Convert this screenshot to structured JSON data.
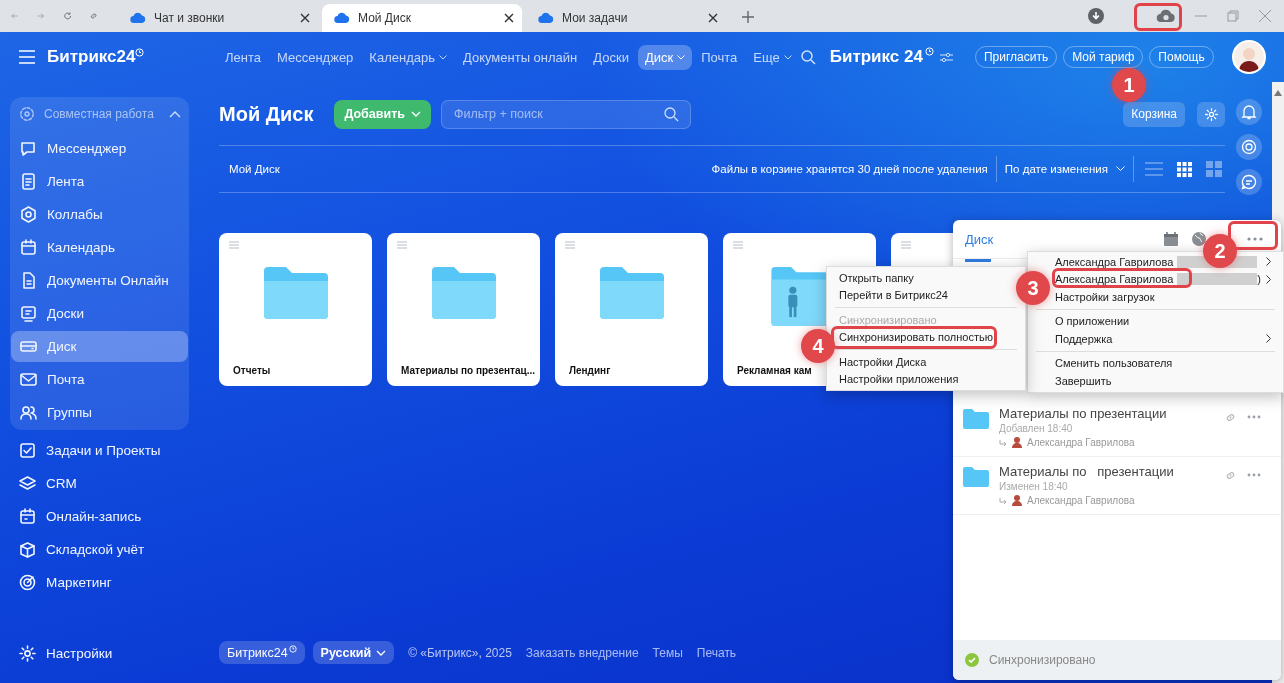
{
  "browser": {
    "tabs": [
      {
        "title": "Чат и звонки",
        "selected": false
      },
      {
        "title": "Мой Диск",
        "selected": true
      },
      {
        "title": "Мои задачи",
        "selected": false
      }
    ]
  },
  "sidebar": {
    "logo": "Битрикс24",
    "group": {
      "title": "Совместная работа",
      "expanded": true,
      "items": [
        {
          "label": "Мессенджер",
          "selected": false
        },
        {
          "label": "Лента",
          "selected": false
        },
        {
          "label": "Коллабы",
          "selected": false
        },
        {
          "label": "Календарь",
          "selected": false
        },
        {
          "label": "Документы Онлайн",
          "selected": false
        },
        {
          "label": "Доски",
          "selected": false
        },
        {
          "label": "Диск",
          "selected": true
        },
        {
          "label": "Почта",
          "selected": false
        },
        {
          "label": "Группы",
          "selected": false
        }
      ]
    },
    "items": [
      {
        "label": "Задачи и Проекты",
        "selected": false
      },
      {
        "label": "CRM",
        "selected": false
      },
      {
        "label": "Онлайн-запись",
        "selected": false
      },
      {
        "label": "Складской учёт",
        "selected": false
      },
      {
        "label": "Маркетинг",
        "selected": false
      }
    ],
    "settings": "Настройки"
  },
  "top_nav": {
    "items": [
      {
        "label": "Лента",
        "selected": false,
        "dropdown": false
      },
      {
        "label": "Мессенджер",
        "selected": false,
        "dropdown": false
      },
      {
        "label": "Календарь",
        "selected": false,
        "dropdown": true
      },
      {
        "label": "Документы онлайн",
        "selected": false,
        "dropdown": false
      },
      {
        "label": "Доски",
        "selected": false,
        "dropdown": false
      },
      {
        "label": "Диск",
        "selected": true,
        "dropdown": true
      },
      {
        "label": "Почта",
        "selected": false,
        "dropdown": false
      },
      {
        "label": "Еще",
        "selected": false,
        "dropdown": true
      }
    ],
    "logo": "Битрикс 24",
    "buttons": [
      "Пригласить",
      "Мой тариф",
      "Помощь"
    ]
  },
  "page": {
    "title": "Мой Диск",
    "add_button": "Добавить",
    "search": {
      "placeholder": "Фильтр + поиск"
    },
    "trash_button": "Корзина",
    "breadcrumb": "Мой Диск",
    "notice": "Файлы в корзине хранятся 30 дней после удаления",
    "sort": "По дате изменения",
    "views": [
      {
        "kind": "list",
        "selected": false
      },
      {
        "kind": "grid",
        "selected": true
      },
      {
        "kind": "tiles",
        "selected": false
      }
    ],
    "cards": [
      {
        "kind": "folder",
        "name": "Отчеты"
      },
      {
        "kind": "folder",
        "name": "Материалы по презентац..."
      },
      {
        "kind": "folder",
        "name": "Лендинг"
      },
      {
        "kind": "shared",
        "name": "Рекламная кам"
      },
      {
        "kind": "partial"
      }
    ]
  },
  "footer": {
    "logo": "Битрикс24",
    "language": "Русский",
    "copyright": "© «Битрикс», 2025",
    "links": [
      "Заказать внедрение",
      "Темы",
      "Печать"
    ]
  },
  "disk_window": {
    "title": "Диск",
    "files": [
      {
        "name": "Материалы по презентации",
        "event": "Добавлен 18:40",
        "author": "Александра Гаврилова"
      },
      {
        "name": "Материалы по   презентации",
        "event": "Изменен 18:40",
        "author": "Александра Гаврилова"
      }
    ],
    "status": "Синхронизировано"
  },
  "account_menu": {
    "items": [
      {
        "kind": "account",
        "label": "Александра Гаврилова",
        "submenu": true
      },
      {
        "kind": "account",
        "label": "Александра Гаврилова",
        "suffix": ")",
        "submenu": true
      },
      {
        "kind": "item",
        "label": "Настройки загрузок",
        "submenu": false
      },
      {
        "kind": "divider"
      },
      {
        "kind": "item",
        "label": "О приложении",
        "submenu": false
      },
      {
        "kind": "item",
        "label": "Поддержка",
        "submenu": true
      },
      {
        "kind": "divider"
      },
      {
        "kind": "item",
        "label": "Сменить пользователя",
        "submenu": false
      },
      {
        "kind": "item",
        "label": "Завершить",
        "submenu": false
      }
    ]
  },
  "context_menu": {
    "items": [
      {
        "kind": "item",
        "label": "Открыть папку",
        "disabled": false
      },
      {
        "kind": "item",
        "label": "Перейти в Битрикс24",
        "disabled": false
      },
      {
        "kind": "divider"
      },
      {
        "kind": "item",
        "label": "Синхронизировано",
        "disabled": true
      },
      {
        "kind": "item",
        "label": "Синхронизировать полностью",
        "disabled": false
      },
      {
        "kind": "divider"
      },
      {
        "kind": "item",
        "label": "Настройки Диска",
        "disabled": false
      },
      {
        "kind": "item",
        "label": "Настройки приложения",
        "disabled": false
      }
    ]
  },
  "callouts": [
    {
      "number": "1"
    },
    {
      "number": "2"
    },
    {
      "number": "3"
    },
    {
      "number": "4"
    }
  ]
}
